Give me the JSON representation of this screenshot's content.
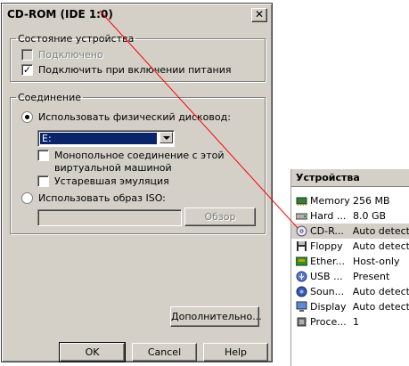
{
  "dialog": {
    "title": "CD-ROM (IDE 1:0)",
    "close_symbol": "✕",
    "device_status": {
      "legend": "Состояние устройства",
      "connected_label": "Подключено",
      "connect_on_power_label": "Подключить при включении питания"
    },
    "connection": {
      "legend": "Соединение",
      "use_physical_label": "Использовать физический дисковод:",
      "drive_value": "E:",
      "exclusive_line1": "Монопольное соединение с этой",
      "exclusive_line2": "виртуальной машиной",
      "legacy_label": "Устаревшая эмуляция",
      "use_iso_label": "Использовать образ ISO:",
      "iso_value": "",
      "browse_label": "Обзор"
    },
    "advanced_label": "Дополнительно...",
    "ok_label": "OK",
    "cancel_label": "Cancel",
    "help_label": "Help"
  },
  "devices_panel": {
    "header": "Устройства",
    "items": [
      {
        "icon": "memory-icon",
        "name": "Memory",
        "value": "256 MB"
      },
      {
        "icon": "hard-disk-icon",
        "name": "Hard ...",
        "value": "8.0 GB"
      },
      {
        "icon": "cdrom-icon",
        "name": "CD-R...",
        "value": "Auto detect"
      },
      {
        "icon": "floppy-icon",
        "name": "Floppy",
        "value": "Auto detect"
      },
      {
        "icon": "ethernet-icon",
        "name": "Ether...",
        "value": "Host-only"
      },
      {
        "icon": "usb-icon",
        "name": "USB ...",
        "value": "Present"
      },
      {
        "icon": "sound-icon",
        "name": "Soun...",
        "value": "Auto detect"
      },
      {
        "icon": "display-icon",
        "name": "Display",
        "value": "Auto detect"
      },
      {
        "icon": "processor-icon",
        "name": "Proce...",
        "value": "1"
      }
    ]
  },
  "colors": {
    "dialog_bg": "#d4d0c8",
    "selection": "#0a246a",
    "annotation_line": "#ff0000"
  }
}
